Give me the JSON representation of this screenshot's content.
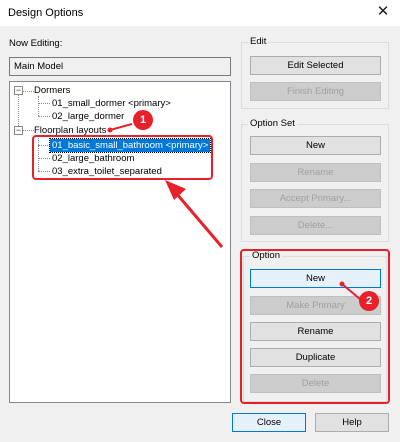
{
  "window": {
    "title": "Design Options",
    "close_glyph": "✕"
  },
  "now_editing": {
    "label": "Now Editing:",
    "value": "Main Model"
  },
  "tree": {
    "groups": [
      {
        "label": "Dormers",
        "items": [
          "01_small_dormer  <primary>",
          "02_large_dormer"
        ]
      },
      {
        "label": "Floorplan layouts",
        "items": [
          "01_basic_small_bathroom  <primary>",
          "02_large_bathroom",
          "03_extra_toilet_separated"
        ]
      }
    ],
    "toggle_glyph": "−"
  },
  "edit_group": {
    "title": "Edit",
    "edit_selected": "Edit Selected",
    "finish_editing": "Finish Editing"
  },
  "option_set_group": {
    "title": "Option Set",
    "new": "New",
    "rename": "Rename",
    "accept_primary": "Accept Primary...",
    "delete": "Delete..."
  },
  "option_group": {
    "title": "Option",
    "new": "New",
    "make_primary": "Make Primary",
    "rename": "Rename",
    "duplicate": "Duplicate",
    "delete": "Delete"
  },
  "footer": {
    "close": "Close",
    "help": "Help"
  },
  "annotations": {
    "badge1": "1",
    "badge2": "2",
    "color": "#e8202a"
  },
  "colors": {
    "selection": "#0078d7",
    "dialog_bg": "#f0f0f0"
  }
}
